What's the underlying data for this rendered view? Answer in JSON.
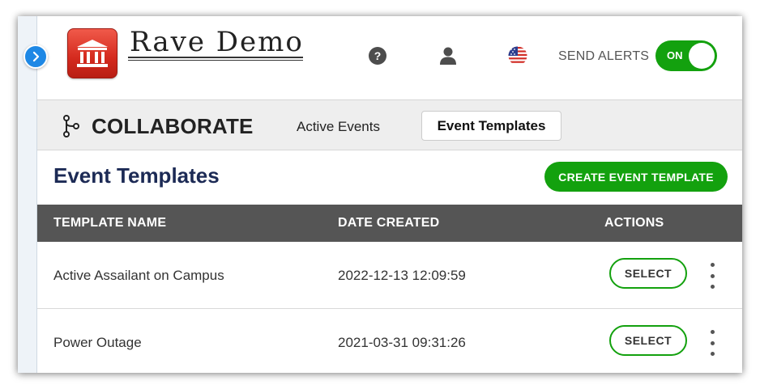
{
  "header": {
    "logo_text": "Rave Demo",
    "logo_icon": "building-columns-icon",
    "help_icon": "question-circle-icon",
    "user_icon": "user-icon",
    "flag_icon": "us-flag-icon",
    "alerts_label": "SEND ALERTS",
    "alerts_toggle": {
      "label": "ON",
      "state": true
    }
  },
  "sidebar": {
    "expand_icon": "chevron-right-icon"
  },
  "collab_bar": {
    "icon": "branch-icon",
    "title": "COLLABORATE",
    "tabs": [
      {
        "label": "Active Events",
        "active": false
      },
      {
        "label": "Event Templates",
        "active": true
      }
    ]
  },
  "page": {
    "title": "Event Templates",
    "create_button": "CREATE EVENT TEMPLATE"
  },
  "table": {
    "columns": [
      "TEMPLATE NAME",
      "DATE CREATED",
      "ACTIONS"
    ],
    "rows": [
      {
        "name": "Active Assailant on Campus",
        "date": "2022-12-13 12:09:59",
        "action": "SELECT"
      },
      {
        "name": "Power Outage",
        "date": "2021-03-31 09:31:26",
        "action": "SELECT"
      }
    ]
  },
  "colors": {
    "accent_green": "#13a10e",
    "title_navy": "#1c2a55",
    "table_header": "#555555",
    "expand_blue": "#1e88e5",
    "logo_red": "#d42a1e"
  }
}
